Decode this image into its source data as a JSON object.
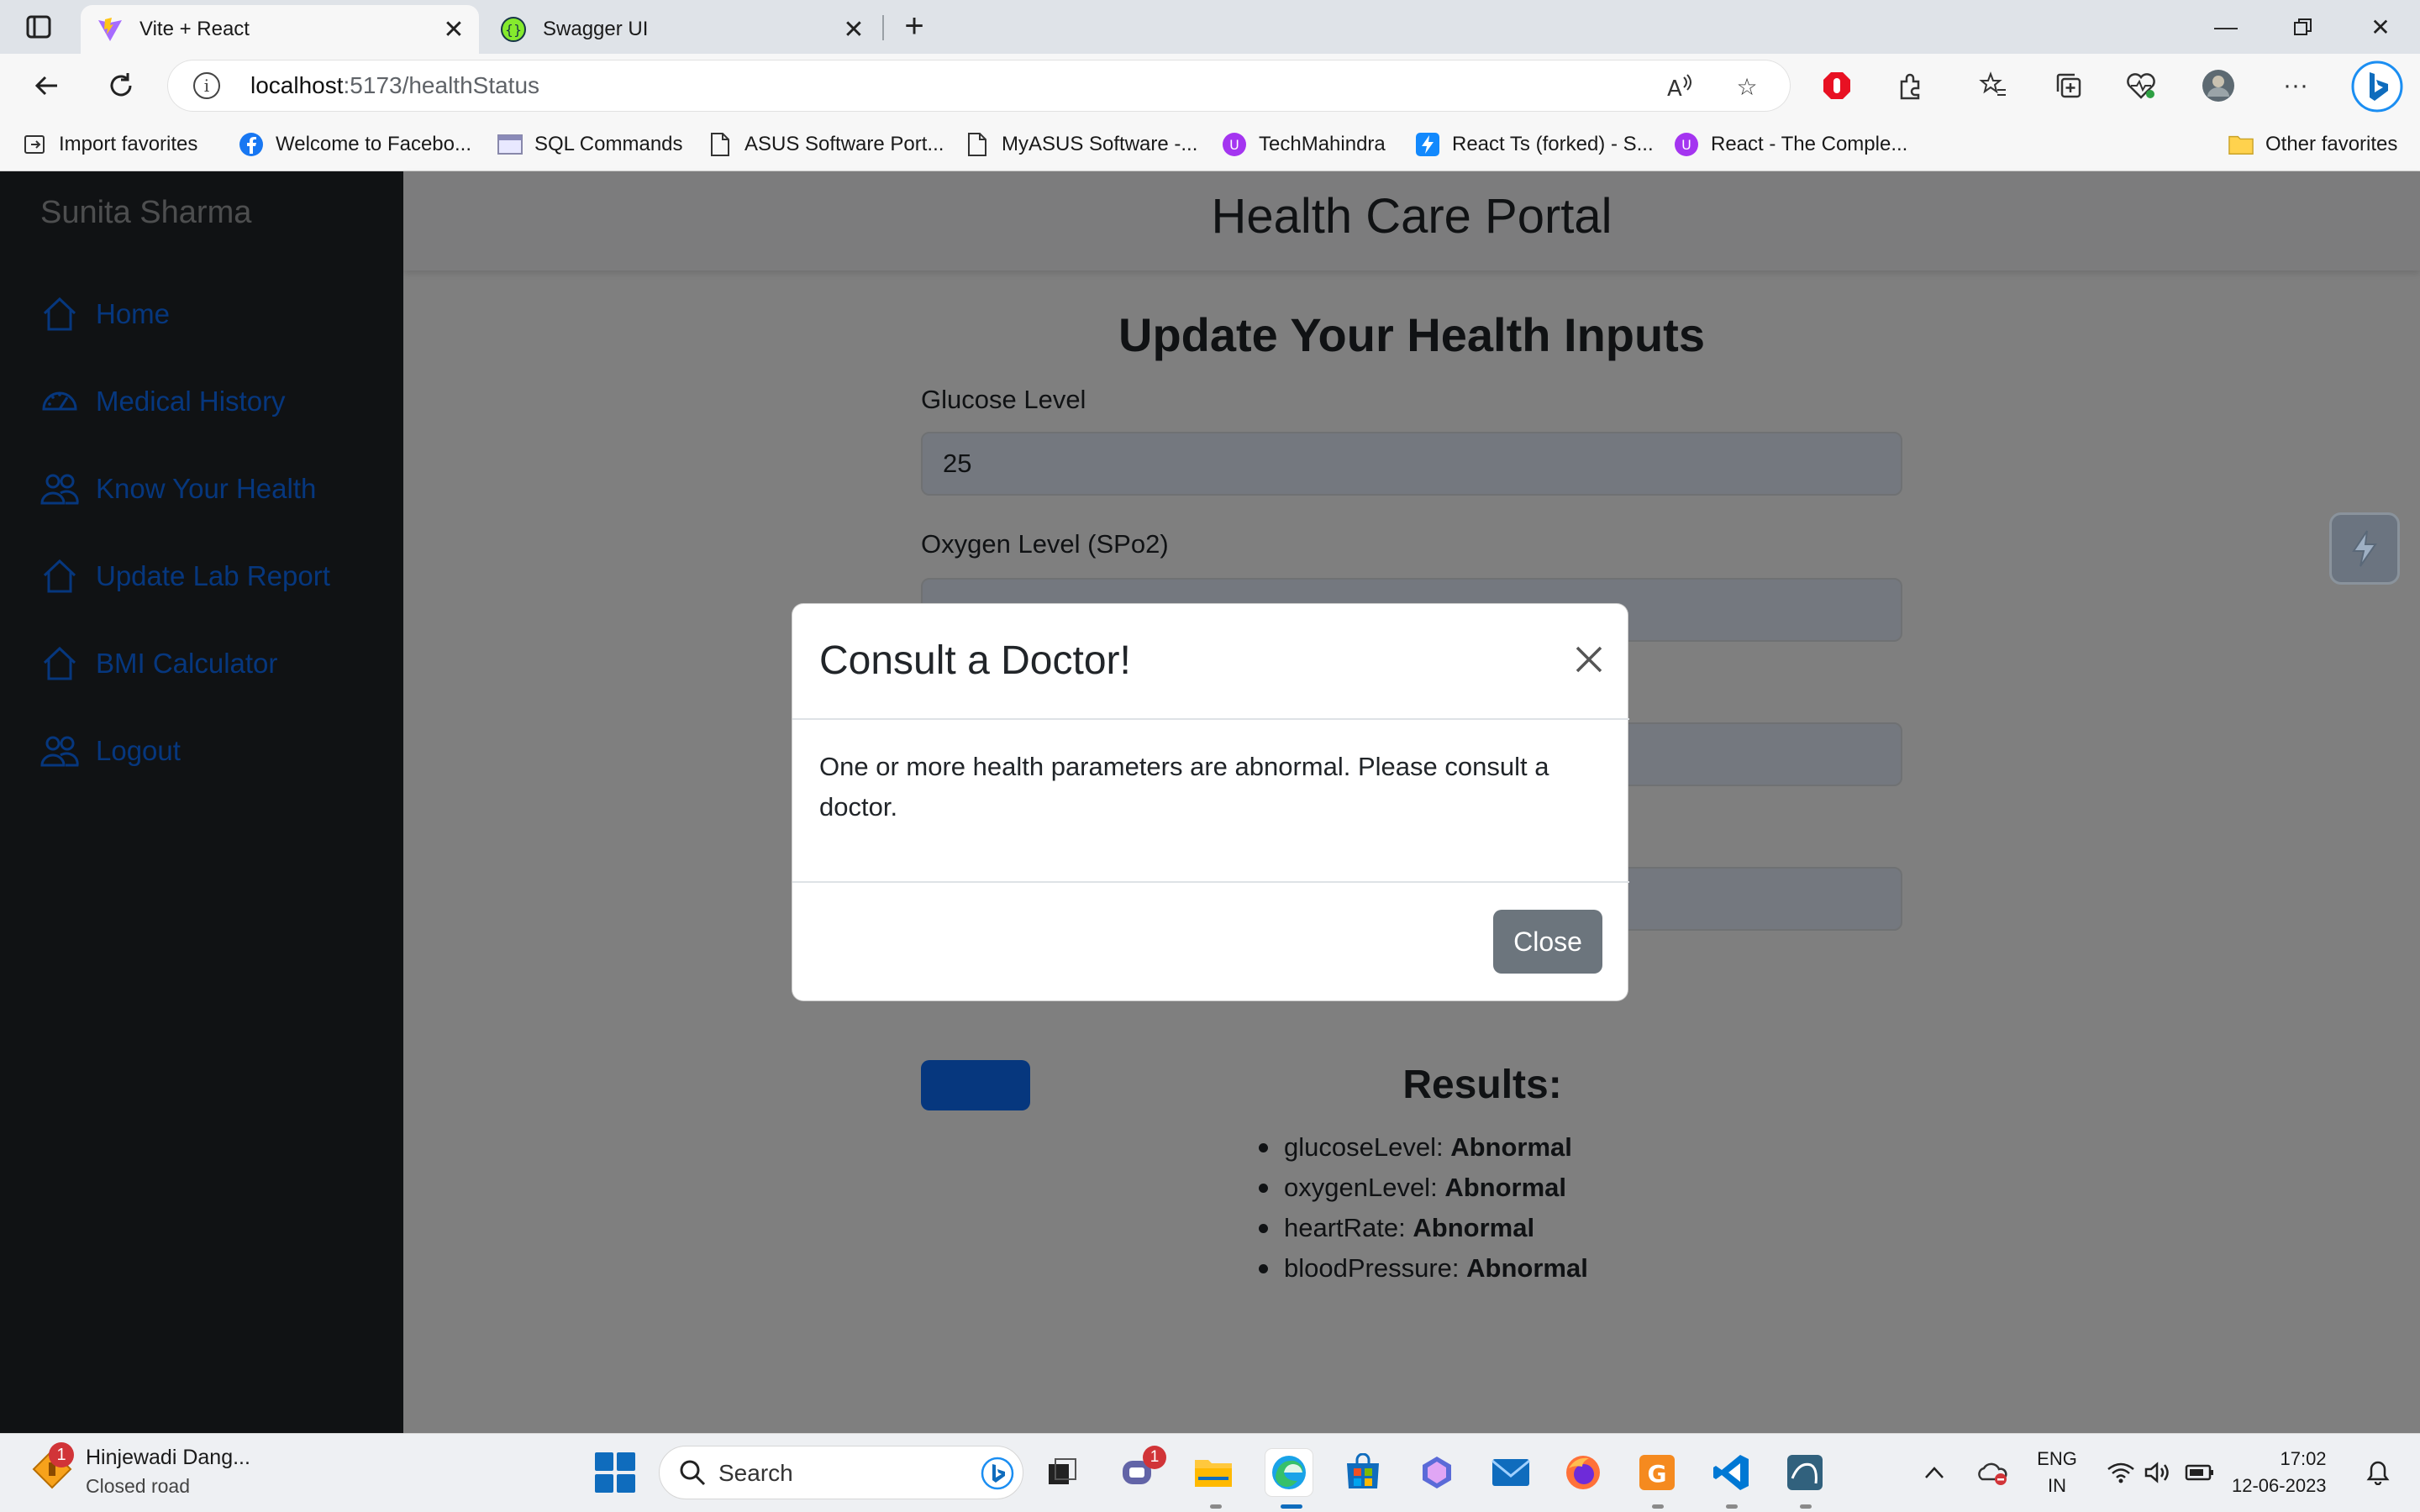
{
  "browser": {
    "tabs": [
      {
        "title": "Vite + React",
        "active": true,
        "icon": "vite-icon"
      },
      {
        "title": "Swagger UI",
        "active": false,
        "icon": "swagger-icon"
      }
    ],
    "url_host": "localhost",
    "url_path": ":5173/healthStatus",
    "favorites": [
      {
        "label": "Import favorites",
        "icon": "import-icon"
      },
      {
        "label": "Welcome to Facebo...",
        "icon": "facebook-icon"
      },
      {
        "label": "SQL Commands",
        "icon": "page-icon"
      },
      {
        "label": "ASUS Software Port...",
        "icon": "document-icon"
      },
      {
        "label": "MyASUS Software -...",
        "icon": "document-icon"
      },
      {
        "label": "TechMahindra",
        "icon": "site-icon"
      },
      {
        "label": "React Ts (forked) - S...",
        "icon": "stackblitz-icon"
      },
      {
        "label": "React - The Comple...",
        "icon": "site-icon"
      }
    ],
    "other_favorites": "Other favorites"
  },
  "sidebar": {
    "user_name": "Sunita Sharma",
    "items": [
      {
        "label": "Home",
        "icon": "home-icon"
      },
      {
        "label": "Medical History",
        "icon": "dashboard-icon"
      },
      {
        "label": "Know Your Health",
        "icon": "people-icon"
      },
      {
        "label": "Update Lab Report",
        "icon": "home-icon"
      },
      {
        "label": "BMI Calculator",
        "icon": "home-icon"
      },
      {
        "label": "Logout",
        "icon": "people-icon"
      }
    ]
  },
  "header": {
    "title": "Health Care Portal"
  },
  "form": {
    "title": "Update Your Health Inputs",
    "glucose_label": "Glucose Level",
    "glucose_value": "25",
    "oxygen_label": "Oxygen Level (SPo2)"
  },
  "results": {
    "title": "Results:",
    "items": [
      {
        "key": "glucoseLevel:",
        "value": "Abnormal"
      },
      {
        "key": "oxygenLevel:",
        "value": "Abnormal"
      },
      {
        "key": "heartRate:",
        "value": "Abnormal"
      },
      {
        "key": "bloodPressure:",
        "value": "Abnormal"
      }
    ]
  },
  "modal": {
    "title": "Consult a Doctor!",
    "body": "One or more health parameters are abnormal. Please consult a doctor.",
    "close_label": "Close"
  },
  "taskbar": {
    "weather_title": "Hinjewadi Dang...",
    "weather_subtitle": "Closed road",
    "weather_badge": "1",
    "search_label": "Search",
    "teams_badge": "1",
    "lang_line1": "ENG",
    "lang_line2": "IN",
    "time": "17:02",
    "date": "12-06-2023"
  },
  "colors": {
    "sidebar_bg": "#212529",
    "link_blue": "#0d6efd",
    "close_btn": "#6c757d"
  }
}
